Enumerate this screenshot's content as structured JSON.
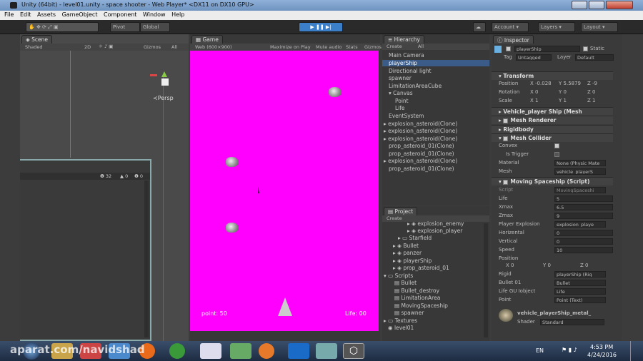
{
  "window": {
    "title": "Unity (64bit) - level01.unity - space shooter - Web Player* <DX11 on DX10 GPU>"
  },
  "menu": [
    "File",
    "Edit",
    "Assets",
    "GameObject",
    "Component",
    "Window",
    "Help"
  ],
  "toolbar": {
    "pivot": "Pivot",
    "global": "Global",
    "account": "Account",
    "layers": "Layers",
    "layout": "Layout"
  },
  "scene": {
    "tab": "Scene",
    "shaded": "Shaded",
    "mode2d": "2D",
    "gizmos": "Gizmos",
    "search": "All",
    "persp": "Persp",
    "console_counts": [
      "32",
      "0",
      "0"
    ]
  },
  "game": {
    "tab": "Game",
    "resolution": "Web (600×900)",
    "maximize": "Maximize on Play",
    "mute": "Mute audio",
    "stats": "Stats",
    "gizmos": "Gizmos",
    "point_text": "point: 50",
    "life_text": "Life: 00",
    "bg_color": "#ff00ff"
  },
  "hierarchy": {
    "tab": "Hierarchy",
    "create": "Create",
    "search": "All",
    "items": [
      "Main Camera",
      "playerShip",
      "Directional light",
      "spawner",
      "LimitationAreaCube",
      "Canvas",
      "Point",
      "Life",
      "EventSystem",
      "explosion_asteroid(Clone)",
      "explosion_asteroid(Clone)",
      "explosion_asteroid(Clone)",
      "prop_asteroid_01(Clone)",
      "prop_asteroid_01(Clone)",
      "explosion_asteroid(Clone)",
      "prop_asteroid_01(Clone)"
    ]
  },
  "project": {
    "tab": "Project",
    "create": "Create",
    "items": [
      "explosion_enemy",
      "explosion_player",
      "Starfield",
      "Bullet",
      "panzer",
      "playerShip",
      "prop_asteroid_01",
      "Scripts",
      "Bullet",
      "Bullet_destroy",
      "LimitationArea",
      "MovingSpaceship",
      "spawner",
      "Textures",
      "level01"
    ]
  },
  "inspector": {
    "tab": "Inspector",
    "name": "playerShip",
    "static": "Static",
    "tag_label": "Tag",
    "tag": "Untagged",
    "layer_label": "Layer",
    "layer": "Default",
    "transform": {
      "title": "Transform",
      "position_label": "Position",
      "px": "-0.028",
      "py": "5.5879",
      "pz": "-9",
      "rotation_label": "Rotation",
      "rx": "0",
      "ry": "0",
      "rz": "0",
      "scale_label": "Scale",
      "sx": "1",
      "sy": "1",
      "sz": "1"
    },
    "mesh_filter": "Vehicle_player Ship (Mesh",
    "mesh_renderer": "Mesh Renderer",
    "rigidbody": "Rigidbody",
    "mesh_collider": "Mesh Collider",
    "collider": {
      "convex": "Convex",
      "is_trigger": "Is Trigger",
      "material_label": "Material",
      "material": "None (Physic Mate",
      "mesh_label": "Mesh",
      "mesh": "vehicle_playerS"
    },
    "script": {
      "title": "Moving Spaceship (Script)",
      "script_label": "Script",
      "script": "MovingSpaceshi",
      "fields": [
        [
          "Life",
          "5"
        ],
        [
          "Xmax",
          "6.5"
        ],
        [
          "Zmax",
          "9"
        ],
        [
          "Player Explosion",
          "explosion_playe"
        ],
        [
          "Horizental",
          "0"
        ],
        [
          "Vertical",
          "0"
        ],
        [
          "Speed",
          "10"
        ]
      ],
      "position_label": "Position",
      "pos_x": "0",
      "pos_y": "0",
      "pos_z": "0",
      "refs": [
        [
          "Rigid",
          "playerShip (Rig"
        ],
        [
          "Bullet 01",
          "Bullet"
        ],
        [
          "Life GU Iobject",
          "Life"
        ],
        [
          "Point",
          "Point (Text)"
        ]
      ]
    },
    "material_name": "vehicle_playerShip_metal_",
    "shader_label": "Shader",
    "shader": "Standard"
  },
  "taskbar": {
    "watermark": "aparat.com/navidshad",
    "lang": "EN",
    "time": "4:53 PM",
    "date": "4/24/2016"
  }
}
